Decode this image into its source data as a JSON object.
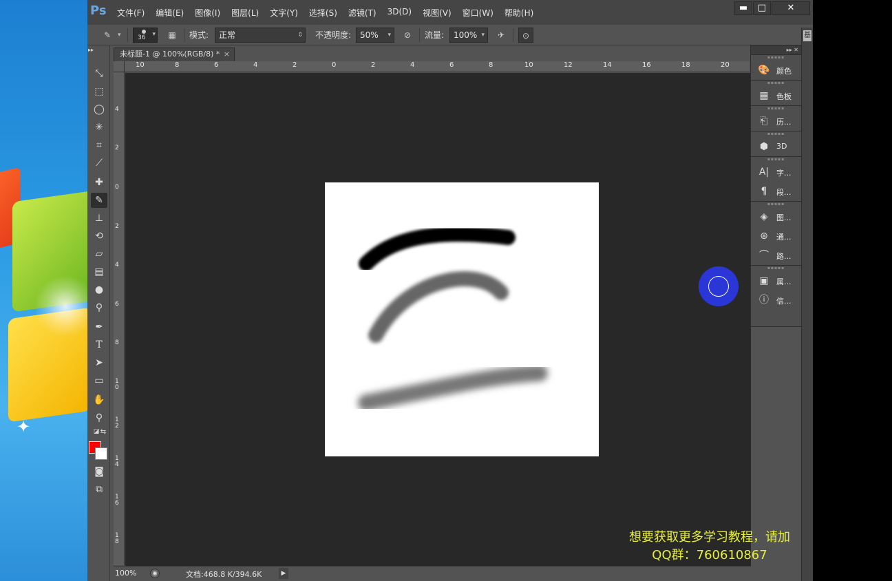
{
  "app": {
    "logo": "Ps"
  },
  "menu": [
    "文件(F)",
    "编辑(E)",
    "图像(I)",
    "图层(L)",
    "文字(Y)",
    "选择(S)",
    "滤镜(T)",
    "3D(D)",
    "视图(V)",
    "窗口(W)",
    "帮助(H)"
  ],
  "window_controls": {
    "minimize": "▬",
    "maximize": "□",
    "close": "✕"
  },
  "options": {
    "brush_size": "36",
    "mode_label": "模式:",
    "mode_value": "正常",
    "opacity_label": "不透明度:",
    "opacity_value": "50%",
    "flow_label": "流量:",
    "flow_value": "100%"
  },
  "document": {
    "tab_title": "未标题-1 @ 100%(RGB/8) *",
    "close_glyph": "×",
    "ruler_top": [
      "10",
      "8",
      "6",
      "4",
      "2",
      "0",
      "2",
      "4",
      "6",
      "8",
      "10",
      "12",
      "14",
      "16",
      "18",
      "20"
    ],
    "ruler_left": [
      "4",
      "2",
      "0",
      "2",
      "4",
      "6",
      "8",
      "10",
      "12",
      "14",
      "16",
      "18"
    ]
  },
  "status": {
    "zoom": "100%",
    "doc_info": "文档:468.8 K/394.6K",
    "arrow": "▶"
  },
  "panels": {
    "collapse": "▸▸  ✕",
    "groups": [
      [
        {
          "icon": "palette-icon",
          "label": "颜色"
        }
      ],
      [
        {
          "icon": "swatches-icon",
          "label": "色板"
        }
      ],
      [
        {
          "icon": "history-icon",
          "label": "历..."
        }
      ],
      [
        {
          "icon": "3d-icon",
          "label": "3D"
        }
      ],
      [
        {
          "icon": "character-icon",
          "label": "字..."
        },
        {
          "icon": "paragraph-icon",
          "label": "段..."
        }
      ],
      [
        {
          "icon": "layers-icon",
          "label": "图..."
        },
        {
          "icon": "channels-icon",
          "label": "通..."
        },
        {
          "icon": "paths-icon",
          "label": "路..."
        }
      ],
      [
        {
          "icon": "properties-icon",
          "label": "属..."
        },
        {
          "icon": "info-icon",
          "label": "信..."
        }
      ]
    ]
  },
  "right_tab": "基",
  "watermark": {
    "line1": "想要获取更多学习教程，请加",
    "line2": "QQ群：760610867"
  },
  "colors": {
    "foreground": "#ff0000",
    "background": "#ffffff",
    "cursor": "#2a36d6"
  }
}
